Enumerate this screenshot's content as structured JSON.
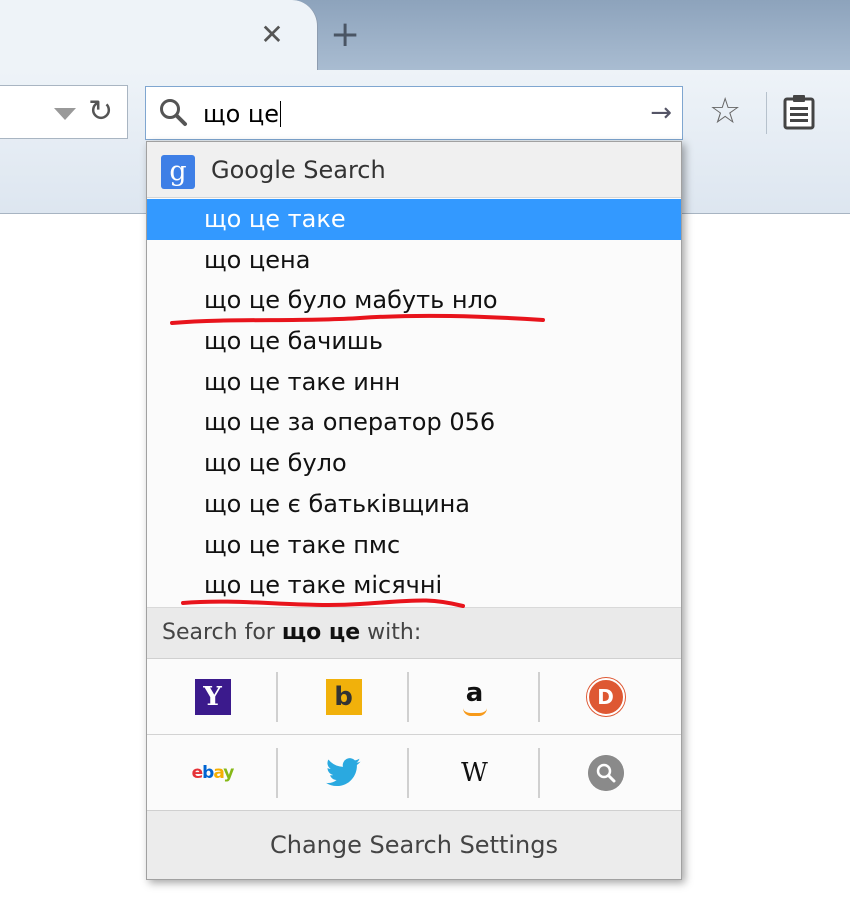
{
  "browser": {
    "tab_close_glyph": "✕",
    "new_tab_glyph": "+",
    "reload_glyph": "↻",
    "search_go_glyph": "→",
    "star_glyph": "☆"
  },
  "search": {
    "value": "що це"
  },
  "popup": {
    "engine_logo_letter": "g",
    "engine_name": "Google Search",
    "suggestions": [
      "що це таке",
      "що цена",
      "що це було мабуть нло",
      "що це бачишь",
      "що це таке инн",
      "що це за оператор 056",
      "що це було",
      "що це є батьківщина",
      "що це таке пмс",
      "що це таке місячні"
    ],
    "selected_index": 0,
    "search_for_prefix": "Search for ",
    "search_for_query": "що це",
    "search_for_suffix": " with:",
    "engines": [
      {
        "name": "Yahoo",
        "icon": "yahoo-icon",
        "glyph": "Y"
      },
      {
        "name": "Bing",
        "icon": "bing-icon",
        "glyph": "b"
      },
      {
        "name": "Amazon",
        "icon": "amazon-icon",
        "glyph": "a"
      },
      {
        "name": "DuckDuckGo",
        "icon": "duckduckgo-icon",
        "glyph": "D"
      },
      {
        "name": "eBay",
        "icon": "ebay-icon",
        "glyph": "ebay"
      },
      {
        "name": "Twitter",
        "icon": "twitter-icon",
        "glyph": ""
      },
      {
        "name": "Wikipedia",
        "icon": "wikipedia-icon",
        "glyph": "W"
      },
      {
        "name": "Other search",
        "icon": "search-icon",
        "glyph": ""
      }
    ],
    "change_settings_label": "Change Search Settings"
  },
  "annotations": {
    "underline_color": "#e8141c",
    "underlined_suggestions": [
      2,
      9
    ]
  },
  "colors": {
    "selection": "#3399ff",
    "google_blue": "#3e7fe6"
  }
}
